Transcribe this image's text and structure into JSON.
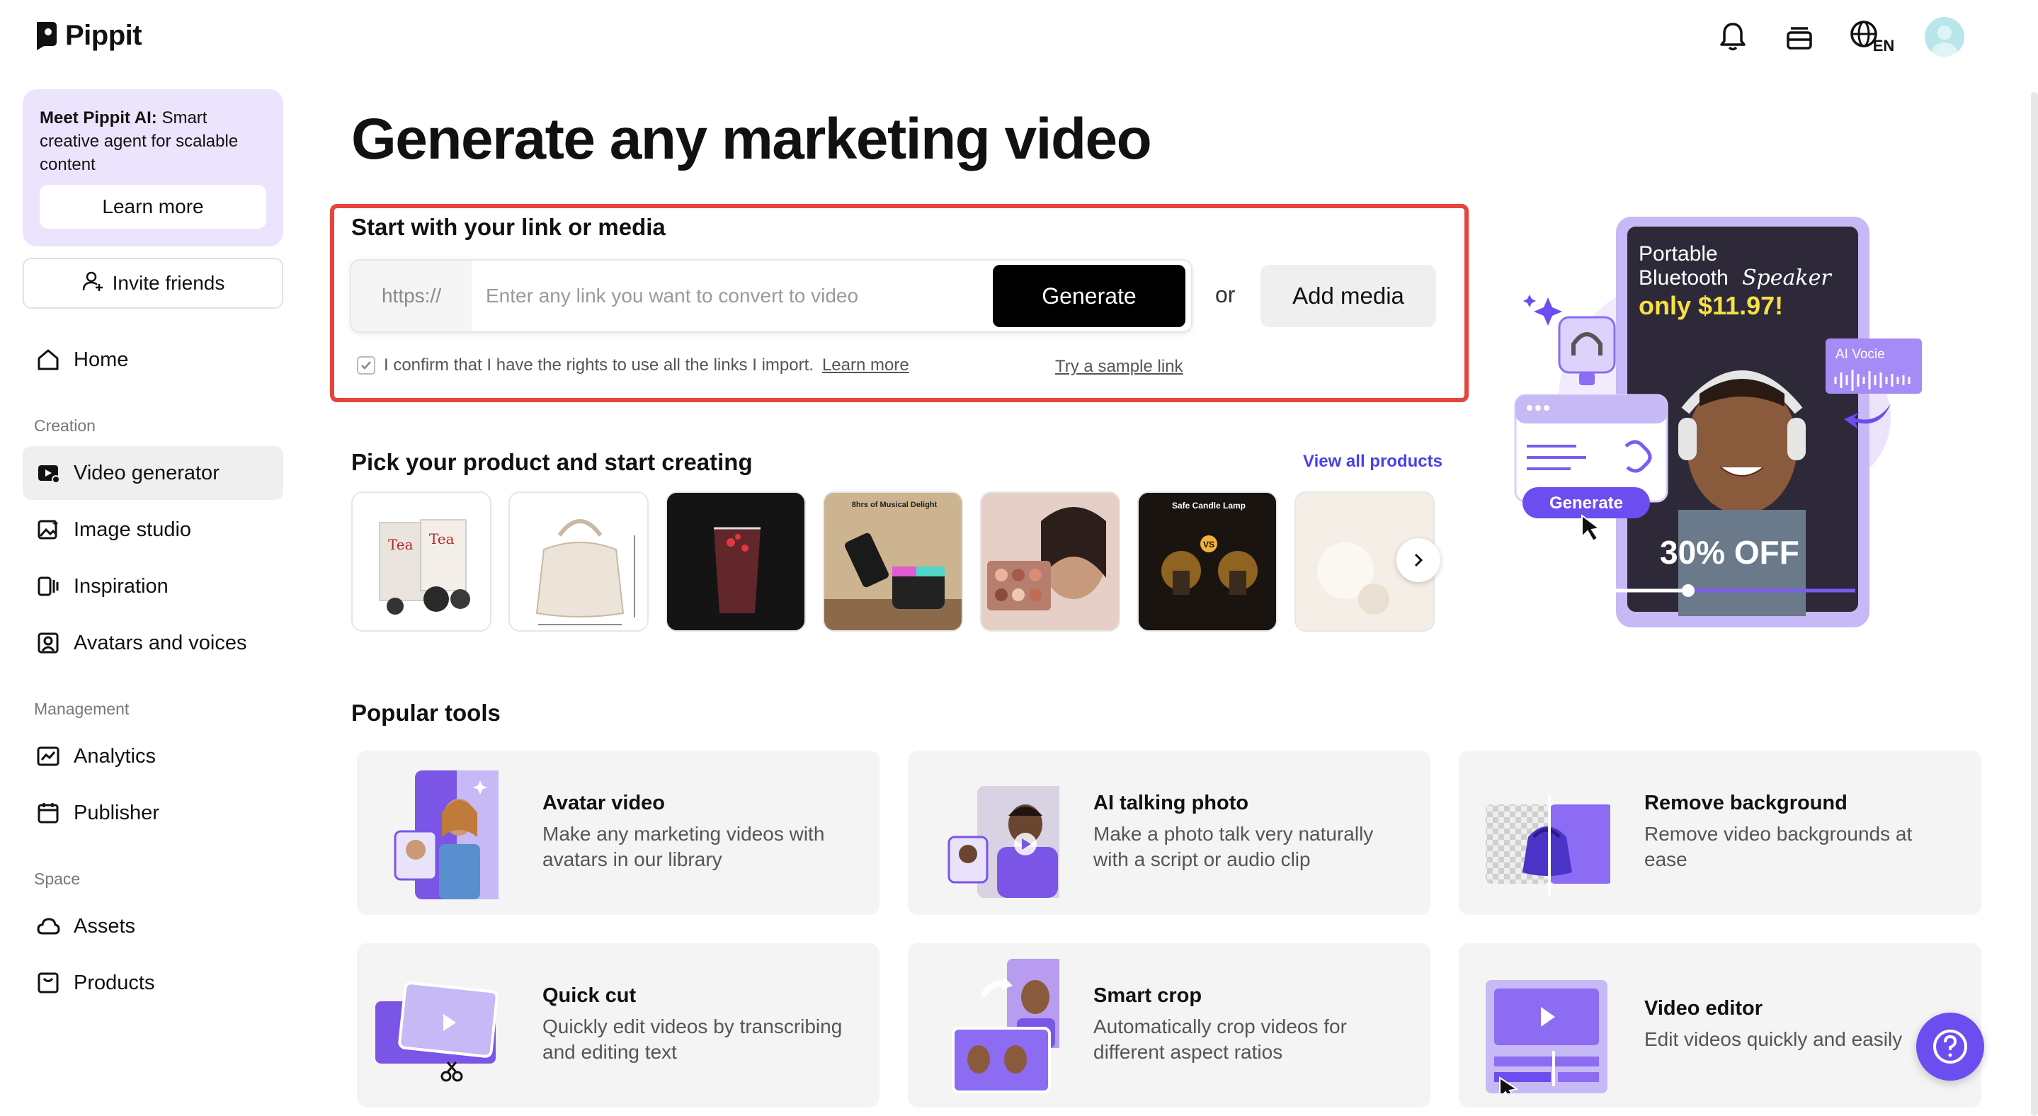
{
  "app": {
    "name": "Pippit",
    "language_code": "EN"
  },
  "sidebar": {
    "promo_text_bold": "Meet Pippit AI:",
    "promo_text": " Smart creative agent for scalable content",
    "promo_button": "Learn more",
    "invite_button": "Invite friends",
    "items": [
      {
        "label": "Home",
        "icon": "home-icon"
      },
      {
        "label": "Video generator",
        "icon": "video-generator-icon",
        "active": true
      },
      {
        "label": "Image studio",
        "icon": "image-studio-icon"
      },
      {
        "label": "Inspiration",
        "icon": "inspiration-icon"
      },
      {
        "label": "Avatars and voices",
        "icon": "avatar-icon"
      },
      {
        "label": "Analytics",
        "icon": "analytics-icon"
      },
      {
        "label": "Publisher",
        "icon": "calendar-icon"
      },
      {
        "label": "Assets",
        "icon": "cloud-icon"
      },
      {
        "label": "Products",
        "icon": "products-icon"
      }
    ],
    "sections": [
      "Creation",
      "Management",
      "Space"
    ]
  },
  "main": {
    "title": "Generate any marketing video",
    "link_section": {
      "heading": "Start with your link or media",
      "prefix": "https://",
      "placeholder": "Enter any link you want to convert to video",
      "generate_button": "Generate",
      "or": "or",
      "add_media_button": "Add media",
      "confirm_text": "I confirm that I have the rights to use all the links I import.",
      "confirm_link": "Learn more",
      "sample_link": "Try a sample link"
    },
    "products": {
      "heading": "Pick your product and start creating",
      "view_all": "View all products",
      "thumb_texts": [
        "8hrs of Musical Delight",
        "Safe Candle Lamp",
        "VS"
      ]
    },
    "hero": {
      "line1": "Portable",
      "line2a": "Bluetooth",
      "line2b": "Speaker",
      "price": "only $11.97!",
      "discount": "30% OFF",
      "ai_voice": "AI Vocie",
      "generate": "Generate"
    },
    "popular": {
      "heading": "Popular tools",
      "tools": [
        {
          "title": "Avatar video",
          "desc": "Make any marketing videos with avatars in our library"
        },
        {
          "title": "AI talking photo",
          "desc": "Make a photo talk very naturally with a script or audio clip"
        },
        {
          "title": "Remove background",
          "desc": "Remove video backgrounds at ease"
        },
        {
          "title": "Quick cut",
          "desc": "Quickly edit videos by transcribing and editing text"
        },
        {
          "title": "Smart crop",
          "desc": "Automatically crop videos for different aspect ratios"
        },
        {
          "title": "Video editor",
          "desc": "Edit videos quickly and easily"
        }
      ]
    }
  },
  "colors": {
    "accent": "#6b4df0",
    "highlight_border": "#e8433f",
    "link_blue": "#4a3ff0",
    "promo_bg": "#ece4fd"
  }
}
